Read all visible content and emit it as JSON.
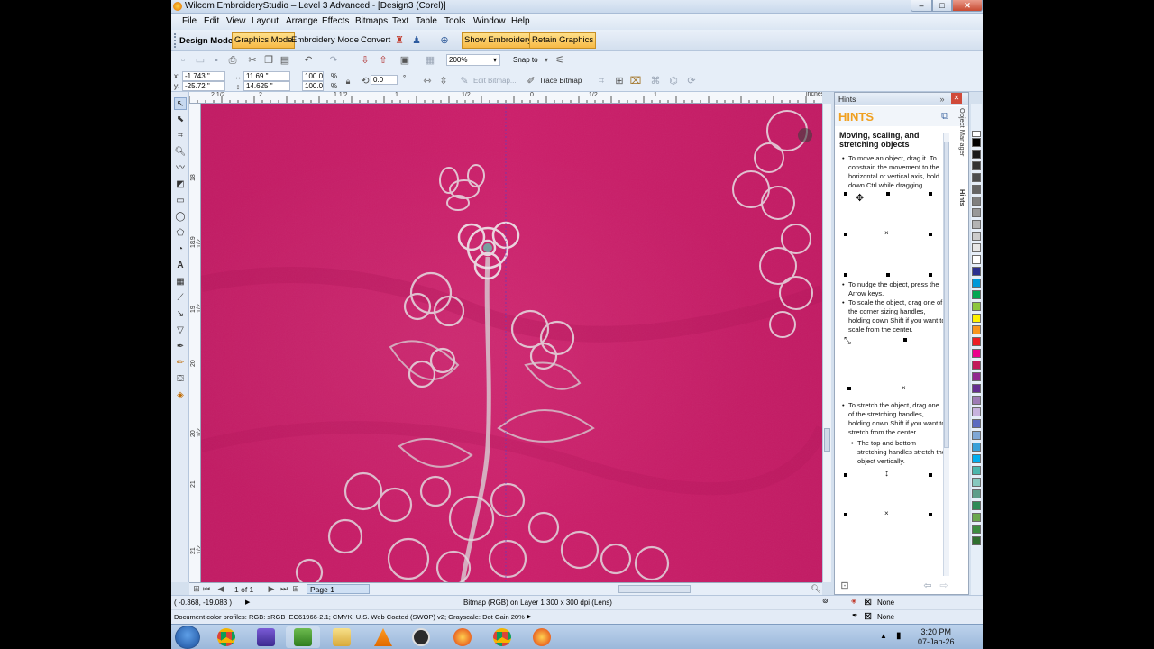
{
  "window": {
    "title": "Wilcom EmbroideryStudio – Level 3 Advanced - [Design3 (Corel)]",
    "min": "–",
    "max": "□",
    "close": "✕"
  },
  "menu": [
    "File",
    "Edit",
    "View",
    "Layout",
    "Arrange",
    "Effects",
    "Bitmaps",
    "Text",
    "Table",
    "Tools",
    "Window",
    "Help"
  ],
  "modebar": {
    "label": "Design Mode:",
    "graphics_mode": "Graphics Mode",
    "embroidery_mode": "Embroidery Mode",
    "convert": "Convert",
    "show_embroidery": "Show Embroidery",
    "retain_graphics": "Retain Graphics"
  },
  "toolbar1": {
    "zoom": "200%",
    "snap_to": "Snap to"
  },
  "propbar": {
    "x_label": "x:",
    "x": "-1.743 \"",
    "y_label": "y:",
    "y": "-25.72 \"",
    "w": "11.69 \"",
    "h": "14.625 \"",
    "sx": "100.0",
    "sy": "100.0",
    "pct": "%",
    "rotation": "0.0",
    "deg": "°",
    "edit_bitmap": "Edit Bitmap...",
    "trace_bitmap": "Trace Bitmap"
  },
  "ruler": {
    "units": "inches",
    "top": [
      "2 1/2",
      "2",
      "1 1/2",
      "1",
      "1/2",
      "0",
      "1/2",
      "1"
    ],
    "left": [
      "18",
      "18 1/2",
      "19",
      "19 1/2",
      "20",
      "20 1/2",
      "21",
      "21 1/2"
    ]
  },
  "nav": {
    "page_count": "1 of 1",
    "page_tab": "Page 1"
  },
  "docker": {
    "panel_title": "Hints",
    "header": "HINTS",
    "heading": "Moving, scaling, and stretching objects",
    "tips": {
      "move": "To move an object, drag it. To constrain the movement to the horizontal or vertical axis, hold down Ctrl while dragging.",
      "nudge": "To nudge the object, press the Arrow keys.",
      "scale": "To scale the object, drag one of the corner sizing handles, holding down Shift if you want to scale from the center.",
      "stretch": "To stretch the object, drag one of the stretching handles, holding down Shift if you want to stretch from the center.",
      "stretch_sub": "The top and bottom stretching handles stretch the object vertically."
    },
    "side_tabs": [
      "Object Manager",
      "Hints"
    ]
  },
  "palette": [
    "#000000",
    "#1a1a1a",
    "#333333",
    "#4d4d4d",
    "#666666",
    "#808080",
    "#999999",
    "#b3b3b3",
    "#cccccc",
    "#e6e6e6",
    "#ffffff",
    "#2b2f8f",
    "#0099d8",
    "#00a651",
    "#8dc63f",
    "#fff200",
    "#f7941d",
    "#ed1c24",
    "#ec008c",
    "#c2185b",
    "#92278f",
    "#662d91",
    "#9e7bb5",
    "#c7b2de",
    "#5c6bc0",
    "#7fa7d6",
    "#3aa0d8",
    "#00aeef",
    "#4cb6ac",
    "#87c8be",
    "#5d9e8a",
    "#2e8b57",
    "#6aa84f",
    "#3c8d40",
    "#2f6f2f"
  ],
  "status": {
    "coords": "( -0.368, -19.083 )",
    "object_info": "Bitmap (RGB) on Layer 1 300 x 300 dpi  (Lens)",
    "profiles": "Document color profiles: RGB: sRGB IEC61966-2.1; CMYK: U.S. Web Coated (SWOP) v2; Grayscale: Dot Gain 20%",
    "fill_none": "None",
    "outline_none": "None"
  },
  "taskbar": {
    "time": "3:20 PM",
    "date": "07-Jan-26"
  }
}
